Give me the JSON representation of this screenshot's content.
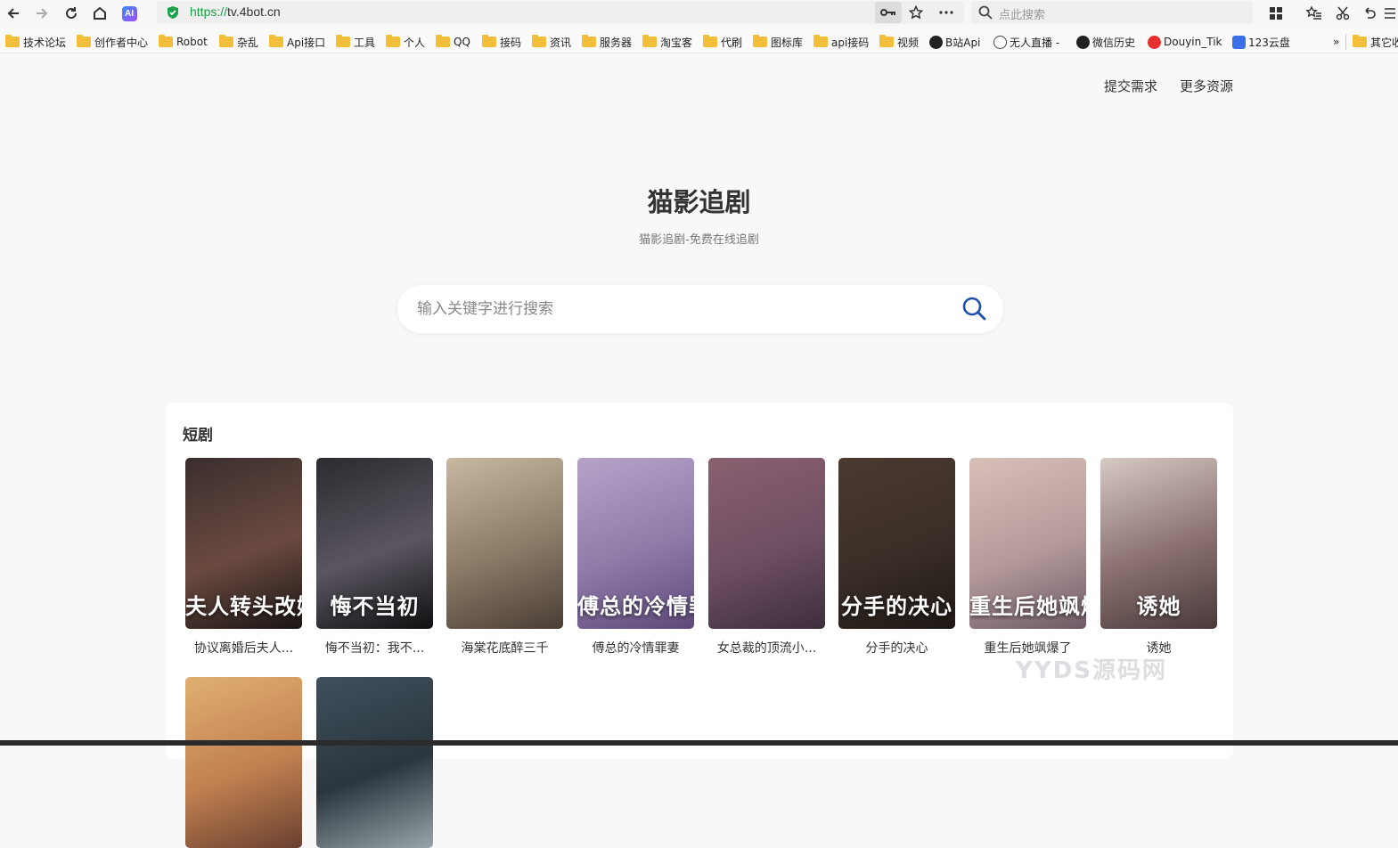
{
  "browser": {
    "url_scheme": "https://",
    "url_host": "tv.4bot.cn",
    "search_placeholder": "点此搜索",
    "ai_badge": "AI",
    "bookmarks": [
      {
        "label": "技术论坛",
        "icon": "folder-icon"
      },
      {
        "label": "创作者中心",
        "icon": "folder-icon"
      },
      {
        "label": "Robot",
        "icon": "folder-icon"
      },
      {
        "label": "杂乱",
        "icon": "folder-icon"
      },
      {
        "label": "Api接口",
        "icon": "folder-icon"
      },
      {
        "label": "工具",
        "icon": "folder-icon"
      },
      {
        "label": "个人",
        "icon": "folder-icon"
      },
      {
        "label": "QQ",
        "icon": "folder-icon"
      },
      {
        "label": "接码",
        "icon": "folder-icon"
      },
      {
        "label": "资讯",
        "icon": "folder-icon"
      },
      {
        "label": "服务器",
        "icon": "folder-icon"
      },
      {
        "label": "淘宝客",
        "icon": "folder-icon"
      },
      {
        "label": "代刷",
        "icon": "folder-icon"
      },
      {
        "label": "图标库",
        "icon": "folder-icon"
      },
      {
        "label": "api接码",
        "icon": "folder-icon"
      },
      {
        "label": "视频",
        "icon": "folder-icon"
      },
      {
        "label": "B站Api",
        "icon": "github-icon"
      },
      {
        "label": "无人直播 -",
        "icon": "globe-icon"
      },
      {
        "label": "微信历史",
        "icon": "github-icon"
      },
      {
        "label": "Douyin_Tik",
        "icon": "weibo-icon"
      },
      {
        "label": "123云盘",
        "icon": "cloud-icon"
      }
    ],
    "more_bookmarks": "»",
    "other_bookmarks": "其它收"
  },
  "page": {
    "nav": {
      "submit": "提交需求",
      "more": "更多资源"
    },
    "title": "猫影追剧",
    "subtitle": "猫影追剧-免费在线追剧",
    "search_placeholder": "输入关键字进行搜索",
    "section_title": "短剧",
    "watermark": "YYDS源码网",
    "items": [
      {
        "title": "协议离婚后夫人...",
        "poster_text": "夫人转头改嫁了",
        "colors": [
          "#3a2e2e",
          "#6b4a40",
          "#1a1515"
        ]
      },
      {
        "title": "悔不当初：我不...",
        "poster_text": "悔不当初",
        "colors": [
          "#2b2b30",
          "#5b5560",
          "#101012"
        ]
      },
      {
        "title": "海棠花底醉三千",
        "poster_text": "",
        "colors": [
          "#c9b8a0",
          "#8a7a66",
          "#4a3e36"
        ]
      },
      {
        "title": "傅总的冷情罪妻",
        "poster_text": "傅总的冷情罪妻",
        "colors": [
          "#b7a3c9",
          "#8d7aa8",
          "#5e4a7a"
        ]
      },
      {
        "title": "女总裁的顶流小...",
        "poster_text": "",
        "colors": [
          "#8a6070",
          "#6e4f62",
          "#3e2e3c"
        ]
      },
      {
        "title": "分手的决心",
        "poster_text": "分手的决心",
        "colors": [
          "#4a3a30",
          "#3a2e28",
          "#1e1814"
        ]
      },
      {
        "title": "重生后她飒爆了",
        "poster_text": "重生后她飒爆了",
        "colors": [
          "#d8c0b8",
          "#b49a9a",
          "#6e5a66"
        ]
      },
      {
        "title": "诱她",
        "poster_text": "诱她",
        "colors": [
          "#d6c9c4",
          "#8a7070",
          "#4a3a3a"
        ]
      },
      {
        "title": "",
        "poster_text": "",
        "colors": [
          "#e0b070",
          "#c08050",
          "#6a4030"
        ]
      },
      {
        "title": "",
        "poster_text": "",
        "colors": [
          "#40505c",
          "#2a363e",
          "#9aa4aa"
        ]
      }
    ]
  }
}
